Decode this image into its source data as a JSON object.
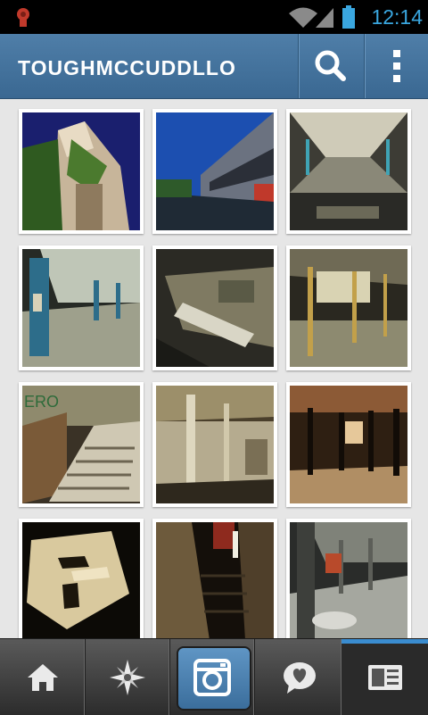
{
  "status_bar": {
    "time": "12:14",
    "icons": [
      "notification-icon",
      "wifi-icon",
      "signal-icon",
      "battery-icon"
    ]
  },
  "header": {
    "username": "TOUGHMCCUDDLLO",
    "search_icon": "search-icon",
    "menu_icon": "overflow-menu-icon"
  },
  "grid": {
    "photos": [
      "photo-1",
      "photo-2",
      "photo-3",
      "photo-4",
      "photo-5",
      "photo-6",
      "photo-7",
      "photo-8",
      "photo-9",
      "photo-10",
      "photo-11",
      "photo-12"
    ]
  },
  "bottom_nav": {
    "items": [
      "home-icon",
      "explore-icon",
      "camera-icon",
      "news-icon",
      "profile-icon"
    ],
    "active": "profile-icon"
  },
  "colors": {
    "header": "#4a79a3",
    "accent": "#3aa7e0",
    "nav": "#3c3c3c"
  }
}
